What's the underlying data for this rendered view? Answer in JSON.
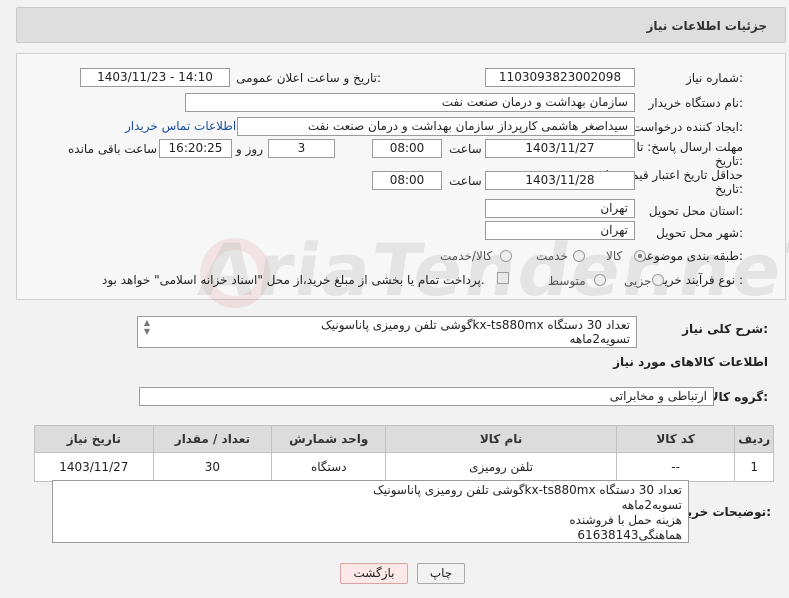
{
  "header": {
    "title": "جزئیات اطلاعات نیاز"
  },
  "fields": {
    "need_number_label": "شماره نیاز:",
    "need_number": "1103093823002098",
    "announce_label": "تاریخ و ساعت اعلان عمومی:",
    "announce_value": "1403/11/23 - 14:10",
    "buyer_org_label": "نام دستگاه خریدار:",
    "buyer_org": "سازمان بهداشت و درمان صنعت نفت",
    "creator_label": "ایجاد کننده درخواست:",
    "creator": "سیداصغر هاشمی کارپرداز سازمان بهداشت و درمان صنعت نفت",
    "contact_link": "اطلاعات تماس خریدار",
    "deadline_label_1": "مهلت ارسال پاسخ: تا",
    "deadline_label_2": "تاریخ:",
    "deadline_date": "1403/11/27",
    "time_label": "ساعت",
    "deadline_time": "08:00",
    "days_value": "3",
    "days_label": "روز و",
    "remaining_time": "16:20:25",
    "remaining_label": "ساعت باقی مانده",
    "price_validity_label_1": "حداقل تاریخ اعتبار قیمت: تا",
    "price_validity_label_2": "تاریخ:",
    "price_validity_date": "1403/11/28",
    "price_validity_time": "08:00",
    "province_label": "استان محل تحویل:",
    "province": "تهران",
    "city_label": "شهر محل تحویل:",
    "city": "تهران",
    "category_label": "طبقه بندی موضوعی:",
    "category_options": [
      "کالا",
      "خدمت",
      "کالا/خدمت"
    ],
    "process_label": "نوع فرآیند خرید :",
    "process_options": [
      "جزیی",
      "متوسط"
    ],
    "payment_note": "پرداخت تمام یا بخشی از مبلغ خرید،از محل \"اسناد خزانه اسلامی\" خواهد بود.",
    "summary_label": "شرح کلی نیاز:",
    "summary_text": "گوشی تلفن رومیزی پاناسونیکkx-ts880mx تعداد 30 دستگاه\nتسویه2ماهه",
    "goods_info_title": "اطلاعات کالاهای مورد نیاز",
    "goods_group_label": "گروه کالا:",
    "goods_group": "ارتباطی و مخابراتی"
  },
  "table": {
    "headers": [
      "ردیف",
      "کد کالا",
      "نام کالا",
      "واحد شمارش",
      "تعداد / مقدار",
      "تاریخ نیاز"
    ],
    "rows": [
      [
        "1",
        "--",
        "تلفن رومیزی",
        "دستگاه",
        "30",
        "1403/11/27"
      ]
    ]
  },
  "buyer_notes": {
    "label": "توضیحات خریدار:",
    "text": "گوشی تلفن رومیزی پاناسونیکkx-ts880mx تعداد 30 دستگاه\nتسویه2ماهه\nهزینه حمل با فروشنده\nهماهنگی61638143"
  },
  "buttons": {
    "print": "چاپ",
    "back": "بازگشت"
  },
  "watermark": "AriaTender.neT"
}
